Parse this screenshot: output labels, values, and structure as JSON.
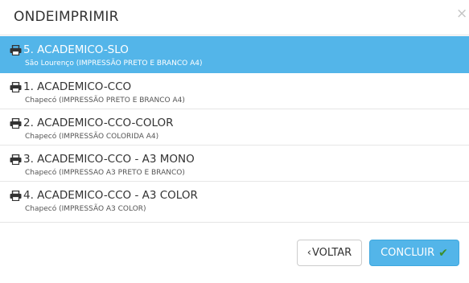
{
  "dialog": {
    "title": "ONDEIMPRIMIR",
    "close_glyph": "×"
  },
  "printers": [
    {
      "name": "5. ACADEMICO-SLO",
      "detail": "São Lourenço (IMPRESSÃO PRETO E BRANCO A4)",
      "selected": true,
      "icon": "printer-icon"
    },
    {
      "name": "1. ACADEMICO-CCO",
      "detail": "Chapecó (IMPRESSÃO PRETO E BRANCO A4)",
      "selected": false,
      "icon": "printer-icon"
    },
    {
      "name": "2. ACADEMICO-CCO-COLOR",
      "detail": "Chapecó (IMPRESSÃO COLORIDA A4)",
      "selected": false,
      "icon": "printer-icon"
    },
    {
      "name": "3. ACADEMICO-CCO - A3 MONO",
      "detail": "Chapecó (IMPRESSAO A3 PRETO E BRANCO)",
      "selected": false,
      "icon": "printer-icon"
    },
    {
      "name": "4. ACADEMICO-CCO - A3 COLOR",
      "detail": "Chapecó (IMPRESSÃO A3 COLOR)",
      "selected": false,
      "icon": "printer-icon"
    }
  ],
  "footer": {
    "back_chevron": "‹",
    "back_label": "VOLTAR",
    "conclude_label": "CONCLUIR",
    "conclude_check": "✔"
  },
  "colors": {
    "accent": "#53b5e9",
    "check": "#3c8f2b"
  }
}
